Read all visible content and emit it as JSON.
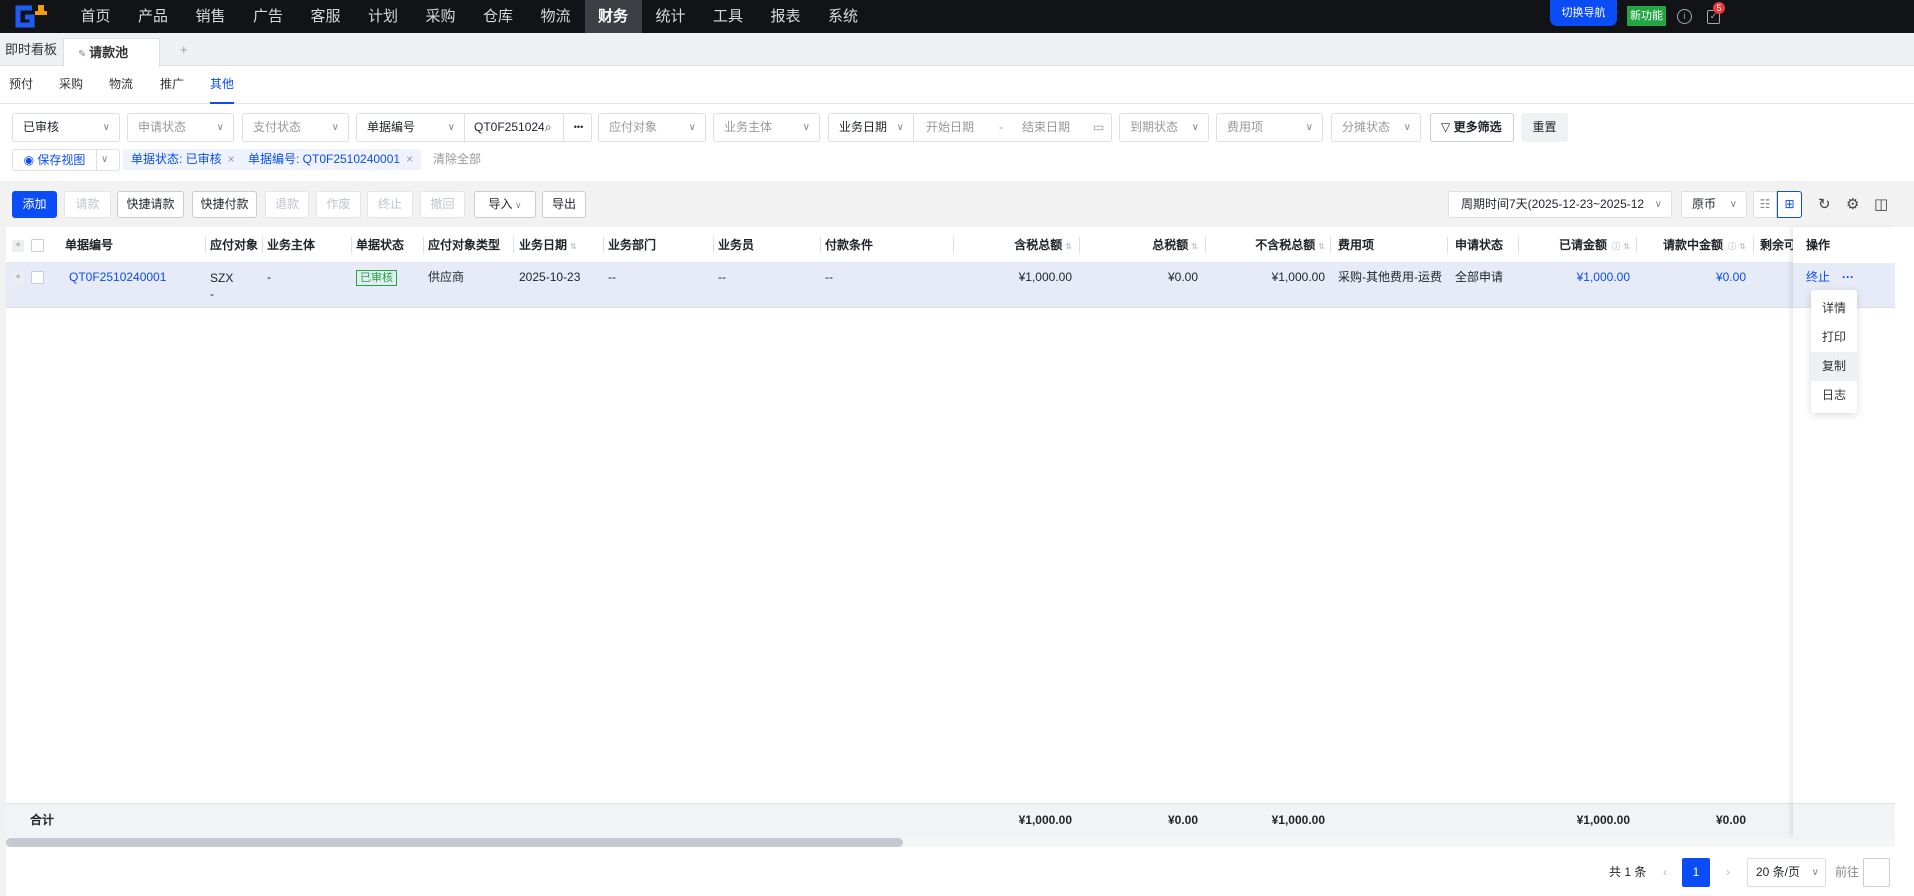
{
  "nav": {
    "items": [
      "首页",
      "产品",
      "销售",
      "广告",
      "客服",
      "计划",
      "采购",
      "仓库",
      "物流",
      "财务",
      "统计",
      "工具",
      "报表",
      "系统"
    ],
    "active": "财务",
    "switch_nav": "切换导航",
    "new_feature": "新功能",
    "notification_count": "5"
  },
  "tabs": {
    "dashboard": "即时看板",
    "active_tab": "请款池",
    "add": "+"
  },
  "subtabs": {
    "items": [
      "预付",
      "采购",
      "物流",
      "推广",
      "其他"
    ],
    "active": "其他"
  },
  "filters": {
    "audit_status": "已审核",
    "apply_status": "申请状态",
    "pay_status": "支付状态",
    "doc_no_field": "单据编号",
    "doc_no_value": "QT0F251024",
    "more_dots": "•••",
    "payee": "应付对象",
    "entity": "业务主体",
    "date_field": "业务日期",
    "start_date": "开始日期",
    "date_sep": "-",
    "end_date": "结束日期",
    "due_status": "到期状态",
    "fee_item": "费用项",
    "alloc_status": "分摊状态",
    "more_filters": "更多筛选",
    "reset": "重置",
    "save_view": "保存视图",
    "chips": [
      "单据状态: 已审核",
      "单据编号: QT0F2510240001"
    ],
    "clear_all": "清除全部"
  },
  "toolbar": {
    "buttons": [
      "添加",
      "请款",
      "快捷请款",
      "快捷付款",
      "退款",
      "作废",
      "终止",
      "撤回",
      "导入",
      "导出"
    ],
    "period": "周期时间7天(2025-12-23~2025-12",
    "currency": "原币"
  },
  "table": {
    "headers": [
      "单据编号",
      "应付对象",
      "业务主体",
      "单据状态",
      "应付对象类型",
      "业务日期",
      "业务部门",
      "业务员",
      "付款条件",
      "含税总额",
      "总税额",
      "不含税总额",
      "费用项",
      "申请状态",
      "已请金额",
      "请款中金额",
      "剩余可",
      "操作"
    ],
    "rows": [
      {
        "doc_no": "QT0F2510240001",
        "payee": "SZX",
        "payee2": "-",
        "entity": "-",
        "status": "已审核",
        "payee_type": "供应商",
        "date": "2025-10-23",
        "dept": "--",
        "staff": "--",
        "terms": "--",
        "total_tax_incl": "¥1,000.00",
        "tax": "¥0.00",
        "total_excl": "¥1,000.00",
        "fee_item": "采购-其他费用-运费",
        "apply_status": "全部申请",
        "requested": "¥1,000.00",
        "requesting": "¥0.00",
        "op_stop": "终止",
        "op_more": "···"
      }
    ],
    "menu": [
      "详情",
      "打印",
      "复制",
      "日志"
    ],
    "footer": {
      "label": "合计",
      "total_tax_incl": "¥1,000.00",
      "tax": "¥0.00",
      "total_excl": "¥1,000.00",
      "requested": "¥1,000.00",
      "requesting": "¥0.00"
    }
  },
  "pagination": {
    "total": "共 1 条",
    "page": "1",
    "page_size": "20 条/页",
    "goto": "前往"
  }
}
